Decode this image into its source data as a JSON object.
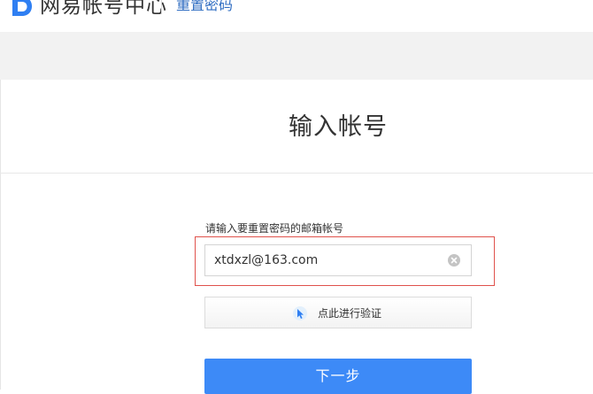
{
  "header": {
    "brand": "网易帐号中心",
    "section_link": "重置密码"
  },
  "main": {
    "title": "输入帐号",
    "email_label": "请输入要重置密码的邮箱帐号",
    "email_value": "xtdxzl@163.com",
    "verify_label": "点此进行验证",
    "next_label": "下一步"
  },
  "icons": {
    "logo": "netease-logo-icon",
    "clear": "clear-icon",
    "verify": "cursor-click-icon"
  },
  "colors": {
    "accent": "#3d8af7",
    "link": "#2f6dc2",
    "highlight_border": "#e0524c",
    "band": "#f2f2f2"
  }
}
